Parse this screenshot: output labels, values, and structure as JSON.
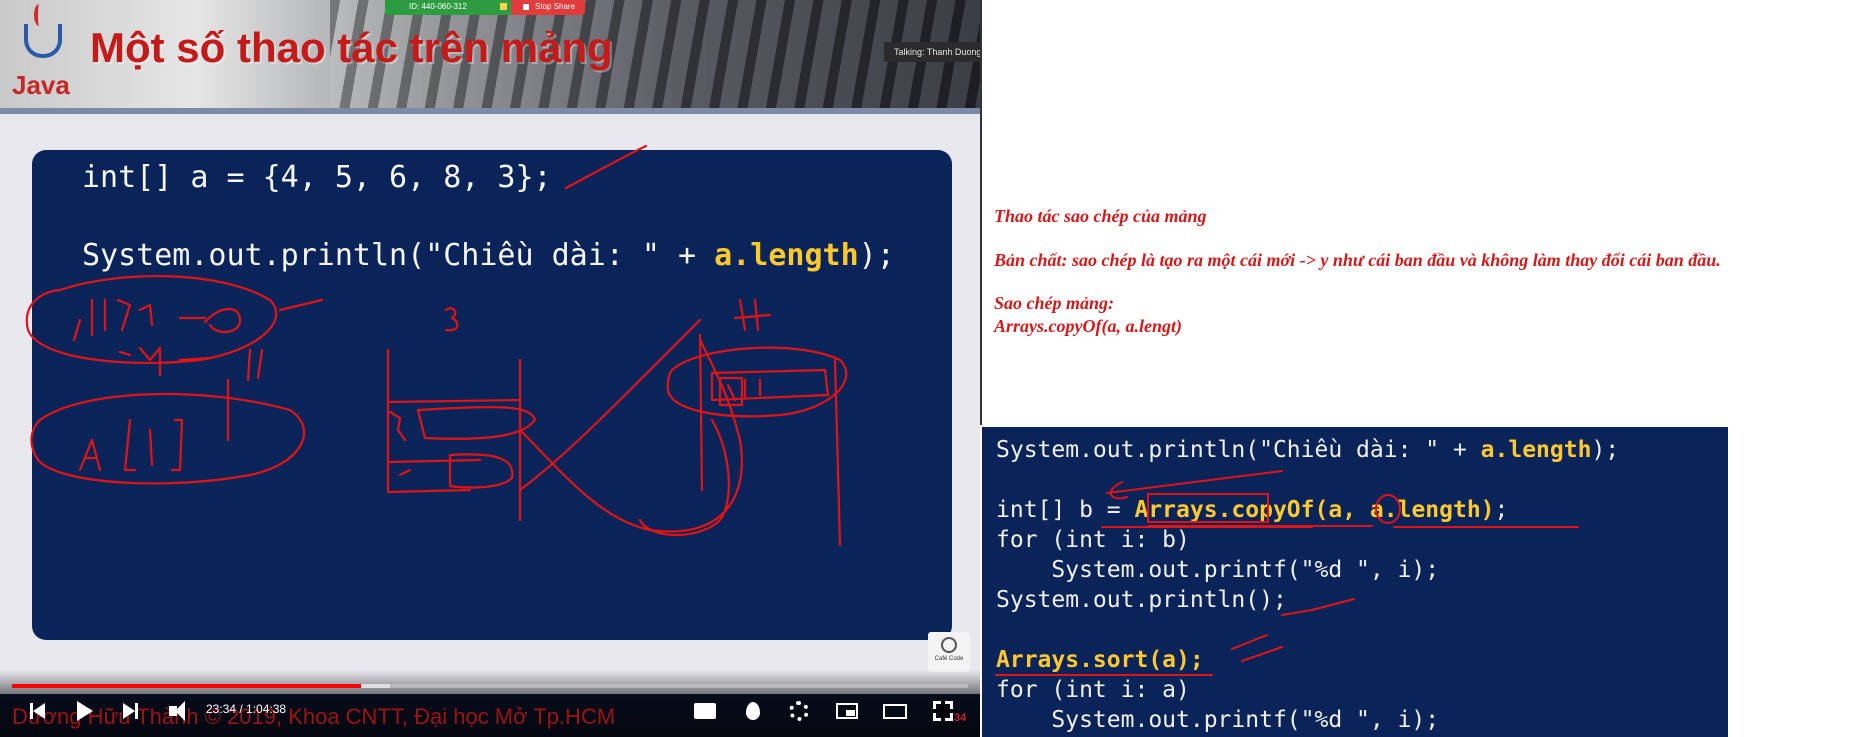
{
  "video": {
    "slide_title": "Một số thao tác trên mảng",
    "java_logo_text": "Java",
    "zoom_meeting_id": "ID: 440-060-312",
    "stop_share_label": "Stop Share",
    "talking_indicator": "Talking: Thanh Duong",
    "code": {
      "line1": "int[] a = {4, 5, 6, 8, 3};",
      "line2_prefix": "System.out.println(\"Chiều dài: \" + ",
      "line2_highlight": "a.length",
      "line2_suffix": ");"
    },
    "cafe_logo_text": "Café Code",
    "watermark": "Dương Hữu Thành © 2019, Khoa CNTT, Đại học Mở Tp.HCM",
    "time_current": "23:34",
    "time_total": "1:04:38",
    "time_separator": " / ",
    "progress_played": 0.365,
    "progress_buffered": 0.395,
    "slide_number": "34",
    "colors": {
      "progress": "#ff0000",
      "code_bg": "#0a2459",
      "keyword": "#ffc92e",
      "ink": "#e01414"
    }
  },
  "notes": {
    "heading": "Thao tác sao chép của mảng",
    "essence": "Bản chất: sao chép là tạo ra một cái mới -> y như cái ban đầu và không làm thay đổi cái ban đầu.",
    "copy_title": "Sao chép mảng:",
    "copy_code": "Arrays.copyOf(a, a.lengt)"
  },
  "snippet": {
    "l1_pre": "System.out.println(\"Chiều dài: \" + ",
    "l1_kw": "a.length",
    "l1_post": ");",
    "l3_pre": "int[] b = ",
    "l3_kw1": "Arrays.copyOf(",
    "l3_mid": "a, ",
    "l3_kw2": "a.length)",
    "l3_post": ";",
    "l4": "for (int i: b)",
    "l5": "    System.out.printf(\"%d \", i);",
    "l6": "System.out.println();",
    "l8_kw": "Arrays.sort(a)",
    "l8_post": ";",
    "l9": "for (int i: a)",
    "l10": "    System.out.printf(\"%d \", i);"
  }
}
